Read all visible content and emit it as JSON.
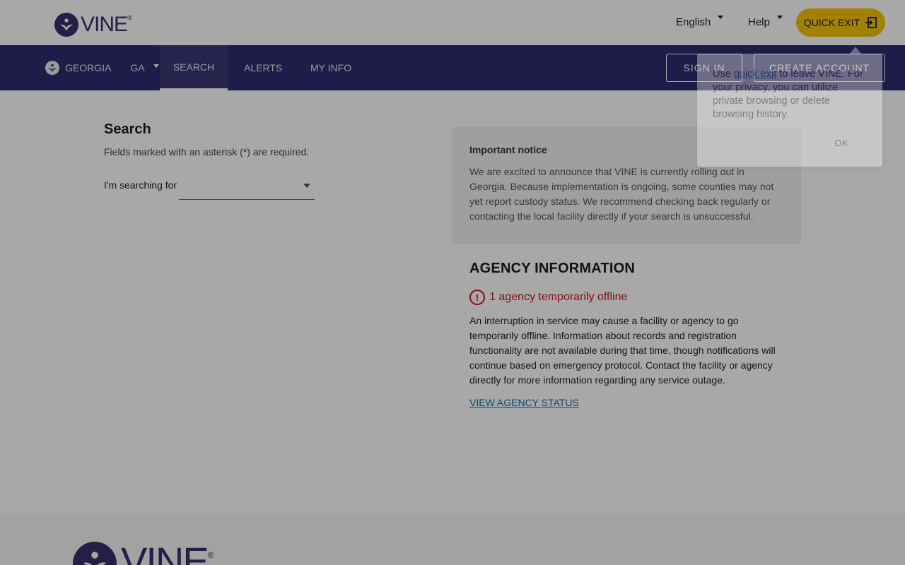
{
  "brand": {
    "name": "VINE",
    "reg_mark": "®"
  },
  "header": {
    "language": "English",
    "help": "Help",
    "quick_exit": "QUICK EXIT"
  },
  "nav": {
    "state_name": "GEORGIA",
    "state_abbr": "GA",
    "links": [
      "SEARCH",
      "ALERTS",
      "MY INFO"
    ],
    "active": "SEARCH",
    "sign_in": "SIGN IN",
    "create_account": "CREATE ACCOUNT"
  },
  "search": {
    "title": "Search",
    "hint": "Fields marked with an asterisk (*) are required.",
    "field_label": "I'm searching for",
    "field_value": ""
  },
  "notice": {
    "title": "Important notice",
    "body": "We are excited to announce that VINE is currently rolling out in Georgia. Because implementation is ongoing, some counties may not yet report custody status. We recommend checking back regularly or contacting the local facility directly if your search is unsuccessful."
  },
  "agency": {
    "title": "AGENCY INFORMATION",
    "offline_icon_text": "!",
    "offline_text": "1 agency temporarily offline",
    "description": "An interruption in service may cause a facility or agency to go temporarily offline. Information about records and registration functionality are not available during that time, though notifications will continue based on emergency protocol. Contact the facility or agency directly for more information regarding any service outage.",
    "link": "VIEW AGENCY STATUS"
  },
  "tooltip": {
    "text_before": "Use ",
    "link": "quick exit",
    "text_after": " to leave VINE. For your privacy, you can utilize private browsing or delete browsing history.",
    "ok": "OK"
  },
  "colors": {
    "nav_bg": "#2e2b6e",
    "brand_purple": "#3b2e6b",
    "quick_exit_yellow": "#f5c400",
    "offline_red": "#c4161c",
    "link_blue": "#1e6aa0",
    "overlay": "rgba(0,0,0,0.34)"
  },
  "icons": {
    "logo": "vine-flower-icon",
    "state": "state-seal-icon",
    "quick_exit": "exit-door-icon",
    "offline": "alert-circle-icon",
    "dropdown": "chevron-down-icon"
  }
}
